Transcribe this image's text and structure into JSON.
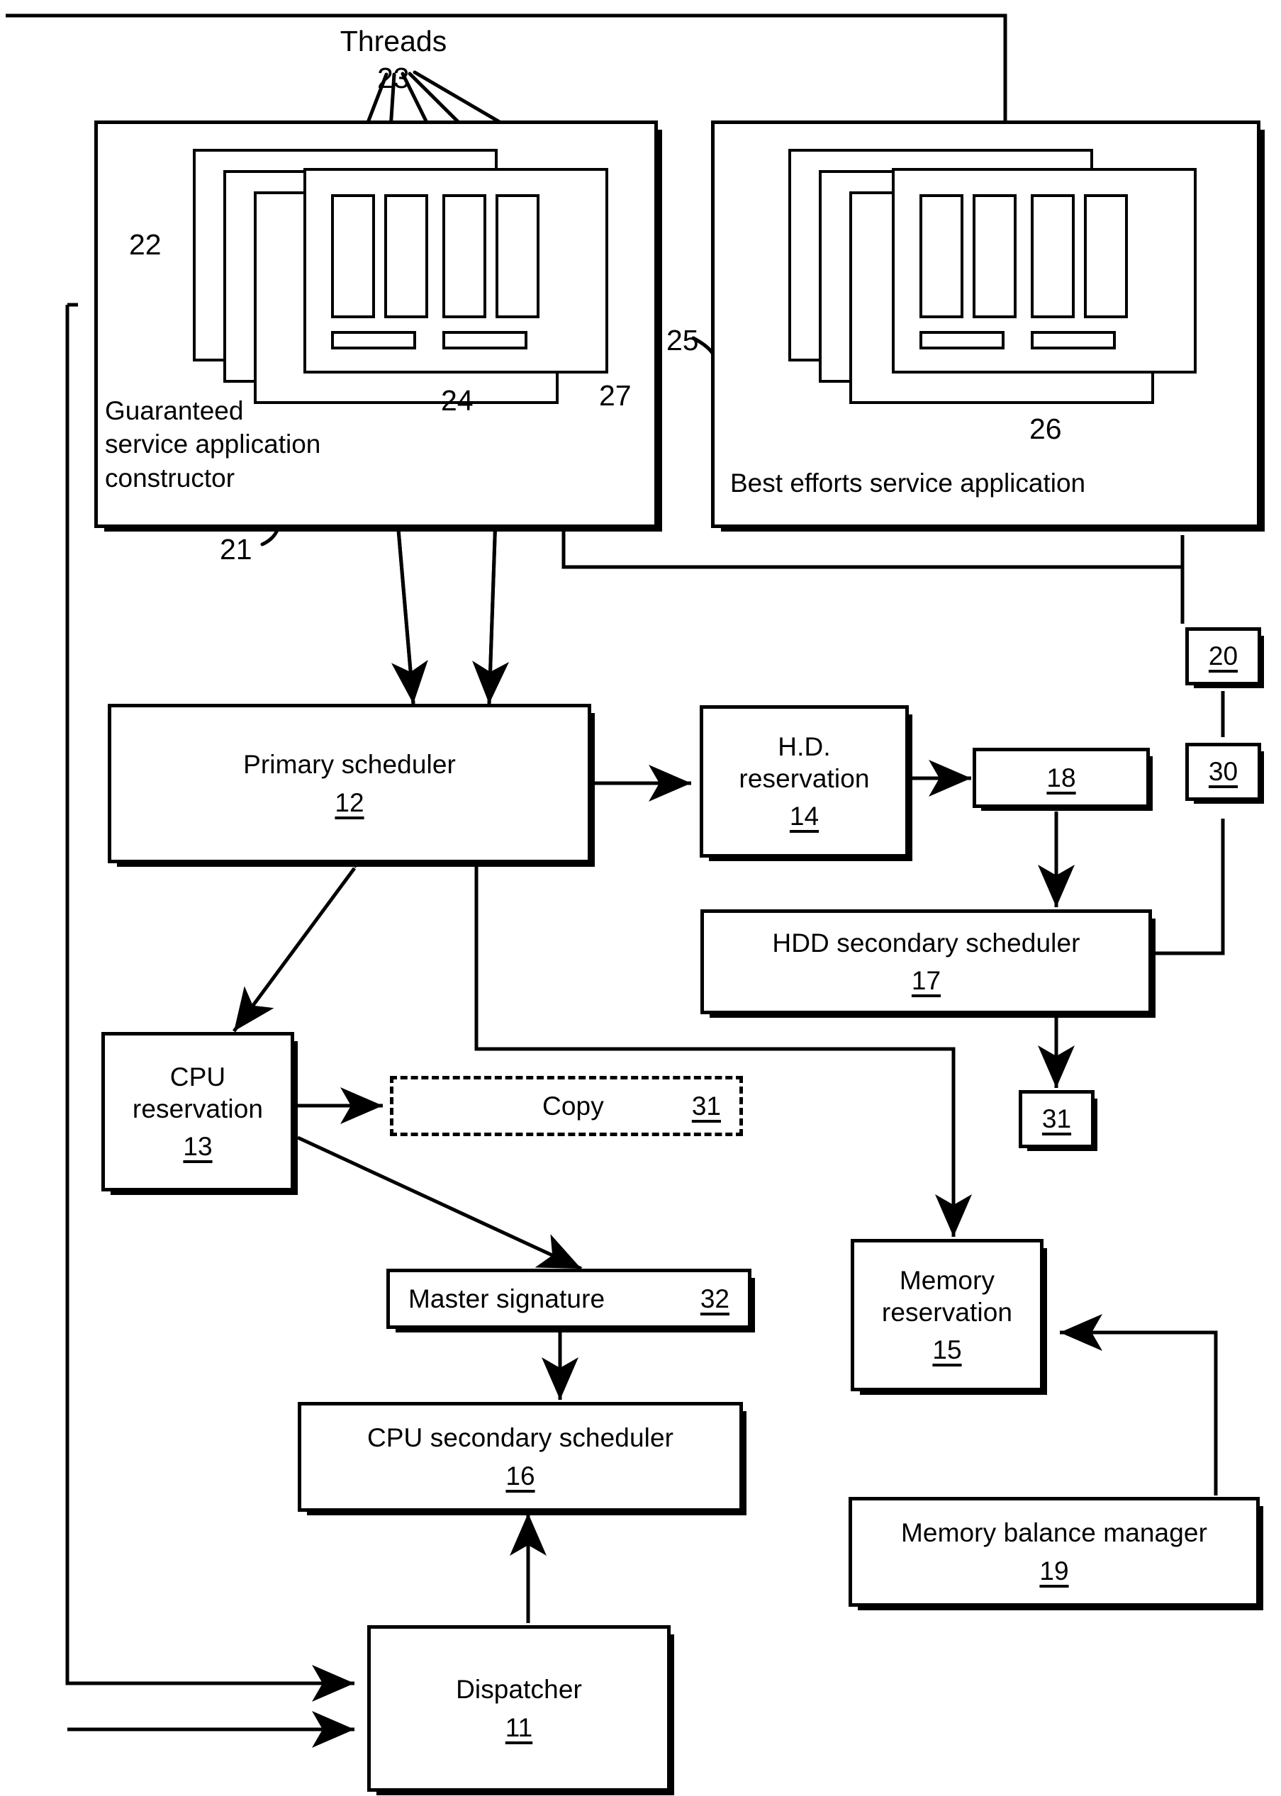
{
  "figure": {
    "type": "patent-block-diagram",
    "annotations": {
      "threads_label": "Threads",
      "threads_ref": "23",
      "apps_ref": "22",
      "gsa_constructor_ref": "21",
      "thread_column_ref": "24",
      "thread_group_ref": "27",
      "best_efforts_ref": "25",
      "best_efforts_items_ref": "26"
    },
    "containers": [
      {
        "id": "gsa",
        "label": "Guaranteed\nservice application\nconstructor",
        "ref": "21"
      },
      {
        "id": "bes",
        "label": "Best efforts service application",
        "ref": "25"
      }
    ],
    "nodes": [
      {
        "id": "primary-scheduler",
        "title": "Primary scheduler",
        "ref": "12"
      },
      {
        "id": "hd-reservation",
        "title": "H.D.\nreservation",
        "ref": "14"
      },
      {
        "id": "node-18",
        "title": "",
        "ref": "18"
      },
      {
        "id": "node-20",
        "title": "",
        "ref": "20"
      },
      {
        "id": "node-30",
        "title": "",
        "ref": "30"
      },
      {
        "id": "hdd-secondary-scheduler",
        "title": "HDD secondary scheduler",
        "ref": "17"
      },
      {
        "id": "node-31-right",
        "title": "",
        "ref": "31"
      },
      {
        "id": "cpu-reservation",
        "title": "CPU\nreservation",
        "ref": "13"
      },
      {
        "id": "copy",
        "title": "Copy",
        "ref": "31"
      },
      {
        "id": "master-signature",
        "title": "Master signature",
        "ref": "32"
      },
      {
        "id": "cpu-secondary-scheduler",
        "title": "CPU secondary scheduler",
        "ref": "16"
      },
      {
        "id": "memory-reservation",
        "title": "Memory\nreservation",
        "ref": "15"
      },
      {
        "id": "memory-balance-manager",
        "title": "Memory balance manager",
        "ref": "19"
      },
      {
        "id": "dispatcher",
        "title": "Dispatcher",
        "ref": "11"
      }
    ],
    "text": {
      "threads": "Threads",
      "n11": "11",
      "n12": "12",
      "n13": "13",
      "n14": "14",
      "n15": "15",
      "n16": "16",
      "n17": "17",
      "n18": "18",
      "n19": "19",
      "n20": "20",
      "n21": "21",
      "n22": "22",
      "n23": "23",
      "n24": "24",
      "n25": "25",
      "n26": "26",
      "n27": "27",
      "n30": "30",
      "n31": "31",
      "n31b": "31",
      "n32": "32",
      "primary_scheduler": "Primary scheduler",
      "hd_reservation_l1": "H.D.",
      "hd_reservation_l2": "reservation",
      "hdd_secondary_scheduler": "HDD secondary scheduler",
      "cpu_reservation_l1": "CPU",
      "cpu_reservation_l2": "reservation",
      "copy": "Copy",
      "master_signature": "Master signature",
      "cpu_secondary_scheduler": "CPU secondary scheduler",
      "memory_reservation_l1": "Memory",
      "memory_reservation_l2": "reservation",
      "memory_balance_manager": "Memory balance manager",
      "dispatcher": "Dispatcher",
      "gsa_l1": "Guaranteed",
      "gsa_l2": "service application",
      "gsa_l3": "constructor",
      "best_efforts": "Best efforts service application"
    }
  }
}
